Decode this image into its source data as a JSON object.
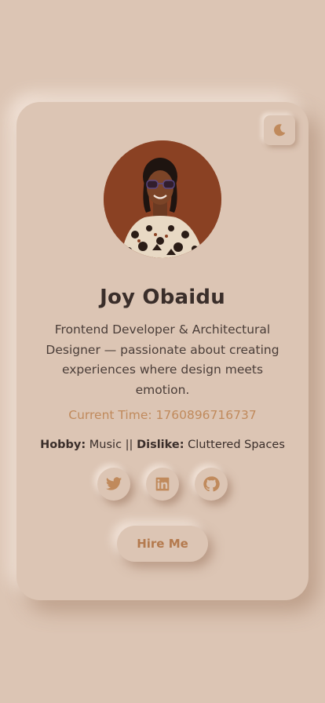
{
  "profile": {
    "name": "Joy Obaidu",
    "bio": "Frontend Developer & Architectural Designer — passionate about creating experiences where design meets emotion.",
    "time_text": "Current Time: 1760896716737"
  },
  "meta": {
    "hobby_label": "Hobby:",
    "hobby_value": "Music",
    "separator": "||",
    "dislike_label": "Dislike:",
    "dislike_value": "Cluttered Spaces"
  },
  "socials": [
    {
      "icon": "twitter-icon"
    },
    {
      "icon": "linkedin-icon"
    },
    {
      "icon": "github-icon"
    }
  ],
  "actions": {
    "hire_label": "Hire Me"
  },
  "theme": {
    "icon": "moon-icon",
    "accent": "#c08a5c",
    "background": "#dcc5b4",
    "text": "#3a2e2a"
  }
}
